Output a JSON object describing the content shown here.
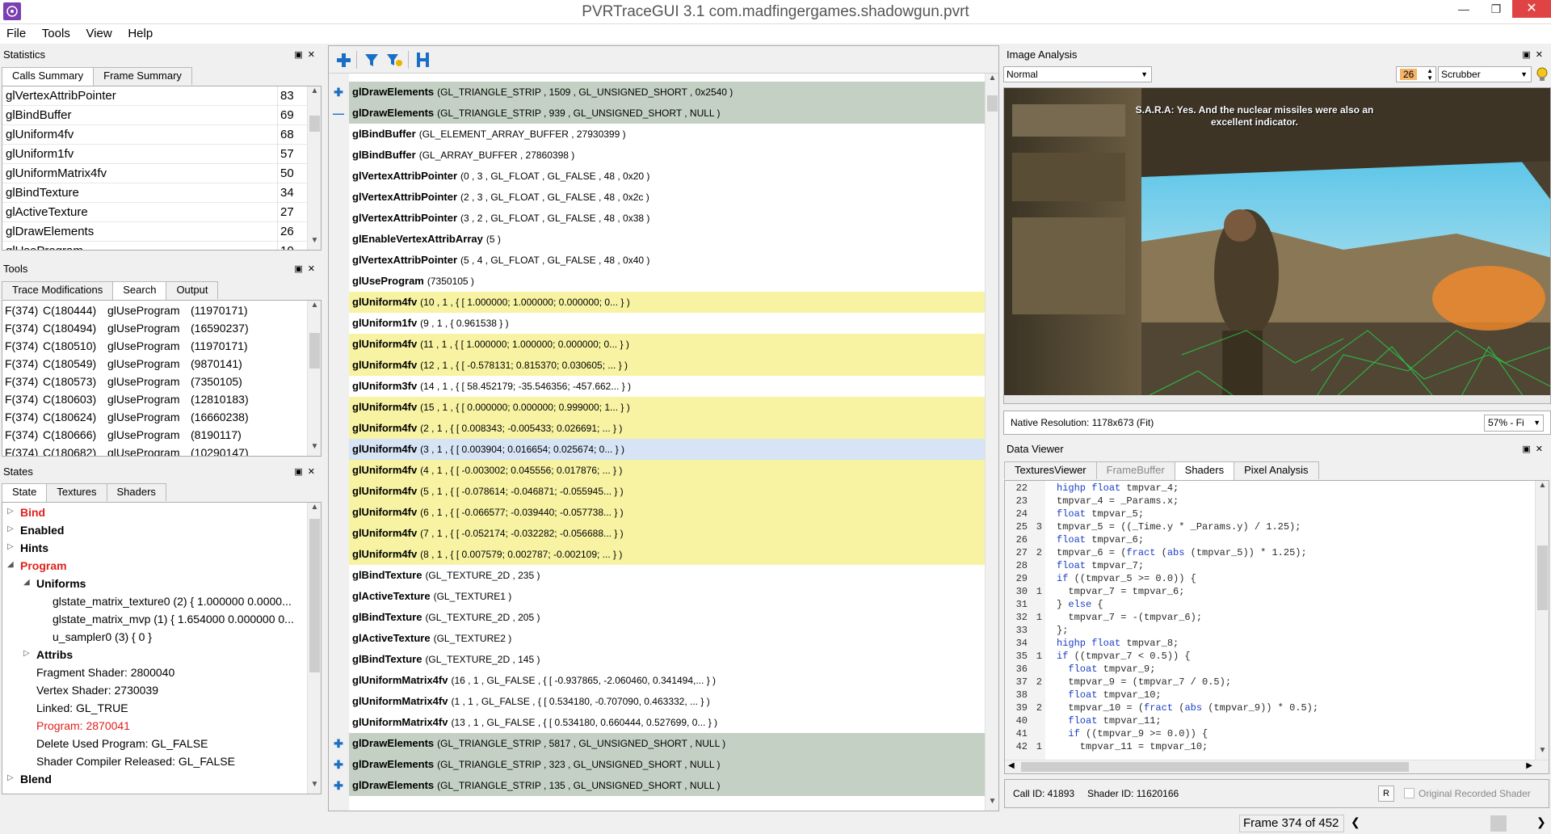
{
  "window": {
    "title": "PVRTraceGUI 3.1 com.madfingergames.shadowgun.pvrt"
  },
  "menu": [
    "File",
    "Tools",
    "View",
    "Help"
  ],
  "statistics": {
    "title": "Statistics",
    "tabs": [
      "Calls Summary",
      "Frame Summary"
    ],
    "rows": [
      {
        "name": "glVertexAttribPointer",
        "count": "83"
      },
      {
        "name": "glBindBuffer",
        "count": "69"
      },
      {
        "name": "glUniform4fv",
        "count": "68"
      },
      {
        "name": "glUniform1fv",
        "count": "57"
      },
      {
        "name": "glUniformMatrix4fv",
        "count": "50"
      },
      {
        "name": "glBindTexture",
        "count": "34"
      },
      {
        "name": "glActiveTexture",
        "count": "27"
      },
      {
        "name": "glDrawElements",
        "count": "26"
      },
      {
        "name": "glUseProgram",
        "count": "10"
      }
    ]
  },
  "tools": {
    "title": "Tools",
    "tabs": [
      "Trace Modifications",
      "Search",
      "Output"
    ],
    "rows": [
      {
        "f": "F(374)",
        "c": "C(180444)",
        "fn": "glUseProgram",
        "arg": "(11970171)"
      },
      {
        "f": "F(374)",
        "c": "C(180494)",
        "fn": "glUseProgram",
        "arg": "(16590237)"
      },
      {
        "f": "F(374)",
        "c": "C(180510)",
        "fn": "glUseProgram",
        "arg": "(11970171)"
      },
      {
        "f": "F(374)",
        "c": "C(180549)",
        "fn": "glUseProgram",
        "arg": "(9870141)"
      },
      {
        "f": "F(374)",
        "c": "C(180573)",
        "fn": "glUseProgram",
        "arg": "(7350105)"
      },
      {
        "f": "F(374)",
        "c": "C(180603)",
        "fn": "glUseProgram",
        "arg": "(12810183)"
      },
      {
        "f": "F(374)",
        "c": "C(180624)",
        "fn": "glUseProgram",
        "arg": "(16660238)"
      },
      {
        "f": "F(374)",
        "c": "C(180666)",
        "fn": "glUseProgram",
        "arg": "(8190117)"
      },
      {
        "f": "F(374)",
        "c": "C(180682)",
        "fn": "glUseProgram",
        "arg": "(10290147)"
      }
    ]
  },
  "states": {
    "title": "States",
    "tabs": [
      "State",
      "Textures",
      "Shaders"
    ],
    "tree": [
      {
        "text": "Bind",
        "level": 0,
        "red": true,
        "bold": true,
        "arrow": "right"
      },
      {
        "text": "Enabled",
        "level": 0,
        "red": false,
        "bold": true,
        "arrow": "right"
      },
      {
        "text": "Hints",
        "level": 0,
        "red": false,
        "bold": true,
        "arrow": "right"
      },
      {
        "text": "Program",
        "level": 0,
        "red": true,
        "bold": true,
        "arrow": "down"
      },
      {
        "text": "Uniforms",
        "level": 1,
        "red": false,
        "bold": true,
        "arrow": "down"
      },
      {
        "text": "glstate_matrix_texture0 (2) { 1.000000 0.0000...",
        "level": 2,
        "red": false,
        "bold": false,
        "arrow": ""
      },
      {
        "text": "glstate_matrix_mvp (1) { 1.654000 0.000000 0...",
        "level": 2,
        "red": false,
        "bold": false,
        "arrow": ""
      },
      {
        "text": "u_sampler0 (3) { 0 }",
        "level": 2,
        "red": false,
        "bold": false,
        "arrow": ""
      },
      {
        "text": "Attribs",
        "level": 1,
        "red": false,
        "bold": true,
        "arrow": "right"
      },
      {
        "text": "Fragment Shader: 2800040",
        "level": 1,
        "red": false,
        "bold": false,
        "arrow": ""
      },
      {
        "text": "Vertex Shader: 2730039",
        "level": 1,
        "red": false,
        "bold": false,
        "arrow": ""
      },
      {
        "text": "Linked: GL_TRUE",
        "level": 1,
        "red": false,
        "bold": false,
        "arrow": ""
      },
      {
        "text": "Program: 2870041",
        "level": 1,
        "red": true,
        "bold": false,
        "arrow": ""
      },
      {
        "text": "Delete Used Program: GL_FALSE",
        "level": 1,
        "red": false,
        "bold": false,
        "arrow": ""
      },
      {
        "text": "Shader Compiler Released: GL_FALSE",
        "level": 1,
        "red": false,
        "bold": false,
        "arrow": ""
      },
      {
        "text": "Blend",
        "level": 0,
        "red": false,
        "bold": true,
        "arrow": "right"
      }
    ]
  },
  "calls": [
    {
      "fn": "glDrawElements",
      "args": "(GL_TRIANGLE_STRIP , 1509 , GL_UNSIGNED_SHORT , 0x2540 )",
      "bg": "draw",
      "gutter": "+"
    },
    {
      "fn": "glDrawElements",
      "args": "(GL_TRIANGLE_STRIP , 939 , GL_UNSIGNED_SHORT , NULL )",
      "bg": "draw",
      "gutter": "-"
    },
    {
      "fn": "glBindBuffer",
      "args": "(GL_ELEMENT_ARRAY_BUFFER , 27930399 )",
      "bg": "white",
      "gutter": ""
    },
    {
      "fn": "glBindBuffer",
      "args": "(GL_ARRAY_BUFFER , 27860398 )",
      "bg": "white",
      "gutter": ""
    },
    {
      "fn": "glVertexAttribPointer",
      "args": "(0 , 3 , GL_FLOAT , GL_FALSE , 48 , 0x20 )",
      "bg": "white",
      "gutter": ""
    },
    {
      "fn": "glVertexAttribPointer",
      "args": "(2 , 3 , GL_FLOAT , GL_FALSE , 48 , 0x2c )",
      "bg": "white",
      "gutter": ""
    },
    {
      "fn": "glVertexAttribPointer",
      "args": "(3 , 2 , GL_FLOAT , GL_FALSE , 48 , 0x38 )",
      "bg": "white",
      "gutter": ""
    },
    {
      "fn": "glEnableVertexAttribArray",
      "args": "(5 )",
      "bg": "white",
      "gutter": ""
    },
    {
      "fn": "glVertexAttribPointer",
      "args": "(5 , 4 , GL_FLOAT , GL_FALSE , 48 , 0x40 )",
      "bg": "white",
      "gutter": ""
    },
    {
      "fn": "glUseProgram",
      "args": "(7350105 )",
      "bg": "white",
      "gutter": ""
    },
    {
      "fn": "glUniform4fv",
      "args": "(10 , 1 , { [ 1.000000; 1.000000; 0.000000; 0... } )",
      "bg": "yellow",
      "gutter": ""
    },
    {
      "fn": "glUniform1fv",
      "args": "(9 , 1 , { 0.961538 } )",
      "bg": "white",
      "gutter": ""
    },
    {
      "fn": "glUniform4fv",
      "args": "(11 , 1 , { [ 1.000000; 1.000000; 0.000000; 0... } )",
      "bg": "yellow",
      "gutter": ""
    },
    {
      "fn": "glUniform4fv",
      "args": "(12 , 1 , { [ -0.578131; 0.815370; 0.030605; ... } )",
      "bg": "yellow",
      "gutter": ""
    },
    {
      "fn": "glUniform3fv",
      "args": "(14 , 1 , { [ 58.452179; -35.546356; -457.662... } )",
      "bg": "white",
      "gutter": ""
    },
    {
      "fn": "glUniform4fv",
      "args": "(15 , 1 , { [ 0.000000; 0.000000; 0.999000; 1... } )",
      "bg": "yellow",
      "gutter": ""
    },
    {
      "fn": "glUniform4fv",
      "args": "(2 , 1 , { [ 0.008343; -0.005433; 0.026691; ... } )",
      "bg": "yellow",
      "gutter": ""
    },
    {
      "fn": "glUniform4fv",
      "args": "(3 , 1 , { [ 0.003904; 0.016654; 0.025674; 0... } )",
      "bg": "selected",
      "gutter": ""
    },
    {
      "fn": "glUniform4fv",
      "args": "(4 , 1 , { [ -0.003002; 0.045556; 0.017876; ... } )",
      "bg": "yellow",
      "gutter": ""
    },
    {
      "fn": "glUniform4fv",
      "args": "(5 , 1 , { [ -0.078614; -0.046871; -0.055945... } )",
      "bg": "yellow",
      "gutter": ""
    },
    {
      "fn": "glUniform4fv",
      "args": "(6 , 1 , { [ -0.066577; -0.039440; -0.057738... } )",
      "bg": "yellow",
      "gutter": ""
    },
    {
      "fn": "glUniform4fv",
      "args": "(7 , 1 , { [ -0.052174; -0.032282; -0.056688... } )",
      "bg": "yellow",
      "gutter": ""
    },
    {
      "fn": "glUniform4fv",
      "args": "(8 , 1 , { [ 0.007579; 0.002787; -0.002109; ... } )",
      "bg": "yellow",
      "gutter": ""
    },
    {
      "fn": "glBindTexture",
      "args": "(GL_TEXTURE_2D , 235 )",
      "bg": "white",
      "gutter": ""
    },
    {
      "fn": "glActiveTexture",
      "args": "(GL_TEXTURE1 )",
      "bg": "white",
      "gutter": ""
    },
    {
      "fn": "glBindTexture",
      "args": "(GL_TEXTURE_2D , 205 )",
      "bg": "white",
      "gutter": ""
    },
    {
      "fn": "glActiveTexture",
      "args": "(GL_TEXTURE2 )",
      "bg": "white",
      "gutter": ""
    },
    {
      "fn": "glBindTexture",
      "args": "(GL_TEXTURE_2D , 145 )",
      "bg": "white",
      "gutter": ""
    },
    {
      "fn": "glUniformMatrix4fv",
      "args": "(16 , 1 , GL_FALSE , { [ -0.937865, -2.060460, 0.341494,... } )",
      "bg": "white",
      "gutter": ""
    },
    {
      "fn": "glUniformMatrix4fv",
      "args": "(1 , 1 , GL_FALSE , { [ 0.534180, -0.707090, 0.463332, ... } )",
      "bg": "white",
      "gutter": ""
    },
    {
      "fn": "glUniformMatrix4fv",
      "args": "(13 , 1 , GL_FALSE , { [ 0.534180, 0.660444, 0.527699, 0... } )",
      "bg": "white",
      "gutter": ""
    },
    {
      "fn": "glDrawElements",
      "args": "(GL_TRIANGLE_STRIP , 5817 , GL_UNSIGNED_SHORT , NULL )",
      "bg": "draw",
      "gutter": "+"
    },
    {
      "fn": "glDrawElements",
      "args": "(GL_TRIANGLE_STRIP , 323 , GL_UNSIGNED_SHORT , NULL )",
      "bg": "draw",
      "gutter": "+"
    },
    {
      "fn": "glDrawElements",
      "args": "(GL_TRIANGLE_STRIP , 135 , GL_UNSIGNED_SHORT , NULL )",
      "bg": "draw",
      "gutter": "+"
    }
  ],
  "image_analysis": {
    "title": "Image Analysis",
    "mode": "Normal",
    "value": "26",
    "scrubber": "Scrubber",
    "caption": "S.A.R.A: Yes. And the nuclear missiles were also an excellent indicator.",
    "native_res": "Native Resolution: 1178x673 (Fit)",
    "zoom": "57% - Fi"
  },
  "data_viewer": {
    "title": "Data Viewer",
    "tabs": [
      "TexturesViewer",
      "FrameBuffer",
      "Shaders",
      "Pixel Analysis"
    ],
    "lines": [
      {
        "n": "22",
        "h": "",
        "t": "highp float tmpvar_4;"
      },
      {
        "n": "23",
        "h": "",
        "t": "tmpvar_4 = _Params.x;"
      },
      {
        "n": "24",
        "h": "",
        "t": "float tmpvar_5;"
      },
      {
        "n": "25",
        "h": "3",
        "t": "tmpvar_5 = ((_Time.y * _Params.y) / 1.25);"
      },
      {
        "n": "26",
        "h": "",
        "t": "float tmpvar_6;"
      },
      {
        "n": "27",
        "h": "2",
        "t": "tmpvar_6 = (fract (abs (tmpvar_5)) * 1.25);"
      },
      {
        "n": "28",
        "h": "",
        "t": "float tmpvar_7;"
      },
      {
        "n": "29",
        "h": "",
        "t": "if ((tmpvar_5 >= 0.0)) {"
      },
      {
        "n": "30",
        "h": "1",
        "t": "  tmpvar_7 = tmpvar_6;"
      },
      {
        "n": "31",
        "h": "",
        "t": "} else {"
      },
      {
        "n": "32",
        "h": "1",
        "t": "  tmpvar_7 = -(tmpvar_6);"
      },
      {
        "n": "33",
        "h": "",
        "t": "};"
      },
      {
        "n": "34",
        "h": "",
        "t": "highp float tmpvar_8;"
      },
      {
        "n": "35",
        "h": "1",
        "t": "if ((tmpvar_7 < 0.5)) {"
      },
      {
        "n": "36",
        "h": "",
        "t": "  float tmpvar_9;"
      },
      {
        "n": "37",
        "h": "2",
        "t": "  tmpvar_9 = (tmpvar_7 / 0.5);"
      },
      {
        "n": "38",
        "h": "",
        "t": "  float tmpvar_10;"
      },
      {
        "n": "39",
        "h": "2",
        "t": "  tmpvar_10 = (fract (abs (tmpvar_9)) * 0.5);"
      },
      {
        "n": "40",
        "h": "",
        "t": "  float tmpvar_11;"
      },
      {
        "n": "41",
        "h": "",
        "t": "  if ((tmpvar_9 >= 0.0)) {"
      },
      {
        "n": "42",
        "h": "1",
        "t": "    tmpvar_11 = tmpvar_10;"
      }
    ],
    "call_id": "Call ID: 41893",
    "shader_id": "Shader ID: 11620166",
    "r_btn": "R",
    "original_label": "Original Recorded Shader"
  },
  "status": {
    "frame": "Frame 374 of 452"
  }
}
